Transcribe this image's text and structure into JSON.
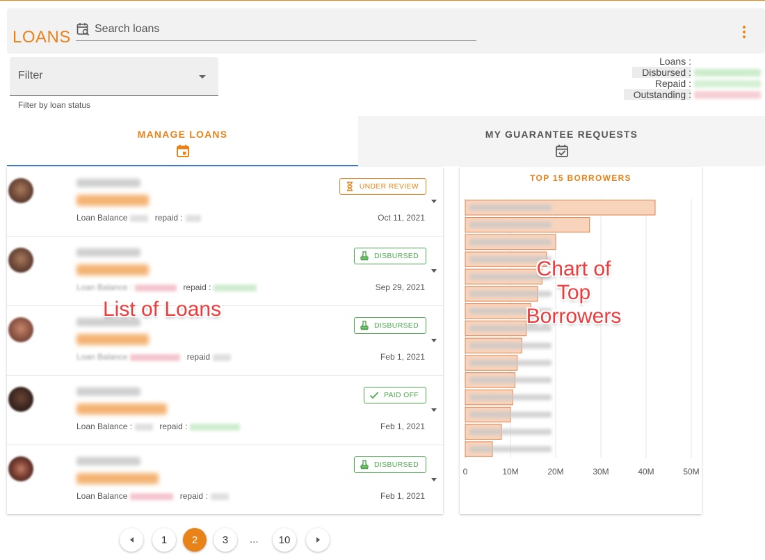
{
  "app": {
    "title": "LOANS"
  },
  "search": {
    "placeholder": "Search loans",
    "icon": "calendar-search-icon"
  },
  "filter": {
    "label": "Filter",
    "helper": "Filter by loan status"
  },
  "summary": [
    {
      "key": "Loans :",
      "color": "#ffffff"
    },
    {
      "key": "Disbursed :",
      "color": "#cdeccd"
    },
    {
      "key": "Repaid :",
      "color": "#d5f0d5"
    },
    {
      "key": "Outstanding :",
      "color": "#f7cfd6"
    }
  ],
  "tabs": [
    {
      "label": "MANAGE LOANS",
      "icon": "calendar-icon",
      "active": true
    },
    {
      "label": "MY GUARANTEE REQUESTS",
      "icon": "calendar-check-icon",
      "active": false
    }
  ],
  "loans": [
    {
      "status": "UNDER REVIEW",
      "status_kind": "review",
      "balance_label": "Loan Balance",
      "repaid_label": "repaid :",
      "date": "Oct 11, 2021",
      "balance_color": "#e0e0e0",
      "repaid_color": "#e0e0e0"
    },
    {
      "status": "DISBURSED",
      "status_kind": "disbursed",
      "balance_label": "Loan Balance :",
      "repaid_label": "repaid :",
      "date": "Sep 29, 2021",
      "balance_color": "#f5c6cf",
      "repaid_color": "#cfeccf"
    },
    {
      "status": "DISBURSED",
      "status_kind": "disbursed",
      "balance_label": "Loan Balance",
      "repaid_label": "repaid",
      "date": "Feb 1, 2021",
      "balance_color": "#f5c6cf",
      "repaid_color": "#e0e0e0"
    },
    {
      "status": "PAID OFF",
      "status_kind": "paid",
      "balance_label": "Loan Balance :",
      "repaid_label": "repaid :",
      "date": "Feb 1, 2021",
      "balance_color": "#e0e0e0",
      "repaid_color": "#cfeccf"
    },
    {
      "status": "DISBURSED",
      "status_kind": "disbursed",
      "balance_label": "Loan Balance",
      "repaid_label": "repaid :",
      "date": "Feb 1, 2021",
      "balance_color": "#f5c6cf",
      "repaid_color": "#e0e0e0"
    }
  ],
  "annotations": {
    "list": "List of Loans",
    "chart": "Chart of\nTop\nBorrowers"
  },
  "chart_data": {
    "type": "bar",
    "orientation": "horizontal",
    "title": "TOP 15 BORROWERS",
    "values": [
      42,
      27.5,
      20,
      18,
      17,
      16,
      14.5,
      13.5,
      12.5,
      11.5,
      11,
      10.5,
      10,
      8,
      6
    ],
    "xlim": [
      0,
      50
    ],
    "xticks": [
      "0",
      "10M",
      "20M",
      "30M",
      "40M",
      "50M"
    ],
    "grid": true,
    "bar_color": "#f8d4bd",
    "bar_edge": "#e0824a"
  },
  "pagination": {
    "pages": [
      "1",
      "2",
      "3",
      "...",
      "10"
    ],
    "current": "2"
  }
}
